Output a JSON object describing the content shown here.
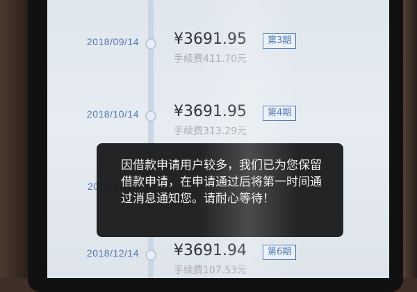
{
  "schedule": {
    "entries": [
      {
        "date": "2018/09/14",
        "amount": "¥3691.95",
        "period": "第3期",
        "fee": "手续费411.70元"
      },
      {
        "date": "2018/10/14",
        "amount": "¥3691.95",
        "period": "第4期",
        "fee": "手续费313.29元"
      },
      {
        "date": "2018/11/14",
        "amount": "",
        "period": "",
        "fee": ""
      },
      {
        "date": "2018/12/14",
        "amount": "¥3691.94",
        "period": "第6期",
        "fee": "手续费107.53元"
      }
    ]
  },
  "toast": {
    "message": "因借款申请用户较多，我们已为您保留借款申请，在申请通过后将第一时间通过消息通知您。请耐心等待！"
  },
  "colors": {
    "date_text": "#4f75b5",
    "period_badge_border": "#3f6fb0",
    "amount_text": "#2f3236",
    "fee_text": "#a8a9ab",
    "toast_bg": "#141416"
  }
}
